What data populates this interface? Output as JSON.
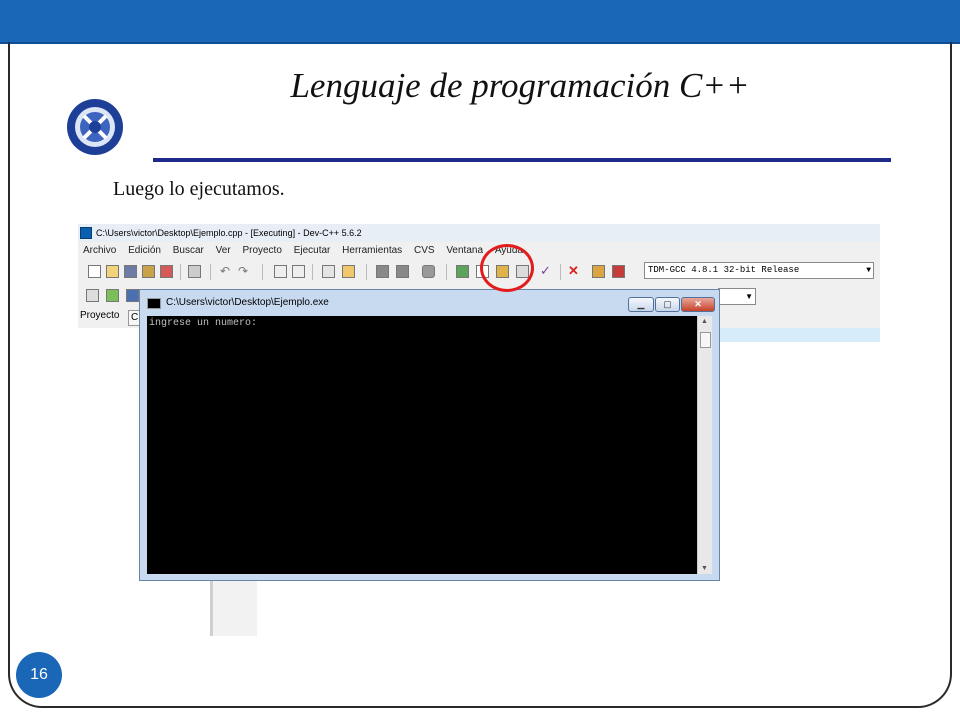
{
  "slide": {
    "title": "Lenguaje de programación C++",
    "subtitle": "Luego lo ejecutamos.",
    "page_number": "16"
  },
  "ide": {
    "window_title": "C:\\Users\\victor\\Desktop\\Ejemplo.cpp - [Executing] - Dev-C++ 5.6.2",
    "menu": [
      "Archivo",
      "Edición",
      "Buscar",
      "Ver",
      "Proyecto",
      "Ejecutar",
      "Herramientas",
      "CVS",
      "Ventana",
      "Ayuda"
    ],
    "compiler": "TDM-GCC 4.8.1 32-bit Release",
    "tab_project": "Proyecto",
    "tab_c": "C"
  },
  "console": {
    "title": "C:\\Users\\victor\\Desktop\\Ejemplo.exe",
    "output": "ingrese un numero:"
  },
  "colors": {
    "accent": "#1a67b8",
    "title_rule": "#1e2a8a",
    "highlight_circle": "#e21c1c"
  }
}
